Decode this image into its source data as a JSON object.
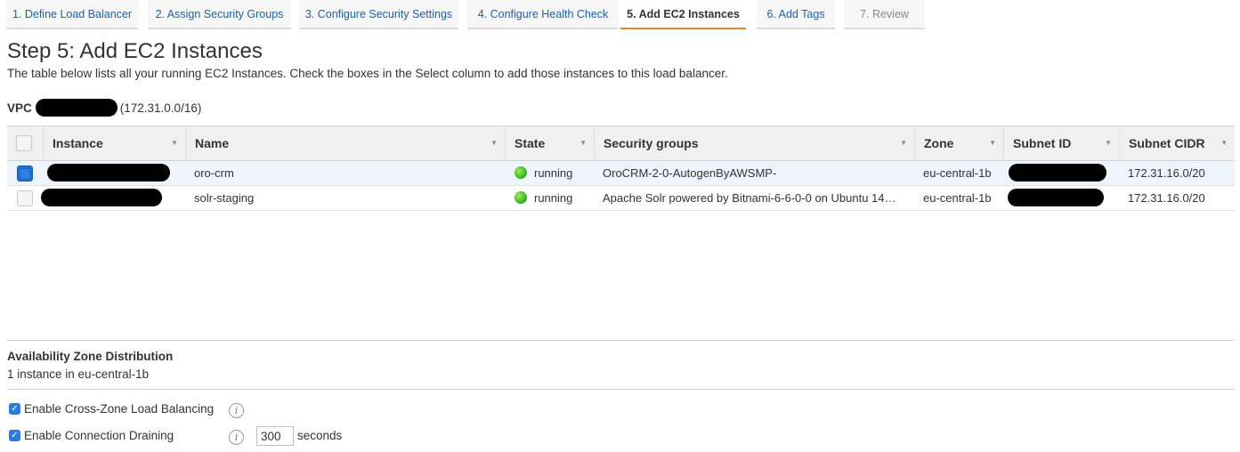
{
  "wizard": {
    "tabs": [
      {
        "label": "1. Define Load Balancer"
      },
      {
        "label": "2. Assign Security Groups"
      },
      {
        "label": "3. Configure Security Settings"
      },
      {
        "label": "4. Configure Health Check"
      },
      {
        "label": "5. Add EC2 Instances"
      },
      {
        "label": "6. Add Tags"
      },
      {
        "label": "7. Review"
      }
    ]
  },
  "page": {
    "title": "Step 5: Add EC2 Instances",
    "description": "The table below lists all your running EC2 Instances. Check the boxes in the Select column to add those instances to this load balancer."
  },
  "vpc": {
    "label": "VPC",
    "cidr": "(172.31.0.0/16)"
  },
  "table": {
    "headers": {
      "instance": "Instance",
      "name": "Name",
      "state": "State",
      "security_groups": "Security groups",
      "zone": "Zone",
      "subnet_id": "Subnet ID",
      "subnet_cidr": "Subnet CIDR"
    },
    "rows": [
      {
        "selected": true,
        "name": "oro-crm",
        "state": "running",
        "security_groups": "OroCRM-2-0-AutogenByAWSMP-",
        "zone": "eu-central-1b",
        "subnet_cidr": "172.31.16.0/20"
      },
      {
        "selected": false,
        "name": "solr-staging",
        "state": "running",
        "security_groups": "Apache Solr powered by Bitnami-6-6-0-0 on Ubuntu 14…",
        "zone": "eu-central-1b",
        "subnet_cidr": "172.31.16.0/20"
      }
    ]
  },
  "az_distribution": {
    "title": "Availability Zone Distribution",
    "text": "1 instance in eu-central-1b"
  },
  "options": {
    "cross_zone_label": "Enable Cross-Zone Load Balancing",
    "cross_zone_checked": true,
    "draining_label": "Enable Connection Draining",
    "draining_checked": true,
    "draining_timeout": "300",
    "draining_unit": "seconds"
  },
  "colors": {
    "active_tab_underline": "#e8842e",
    "link": "#1f5fa6",
    "checkbox_checked": "#1f6fd1",
    "running": "#2fae1c"
  }
}
